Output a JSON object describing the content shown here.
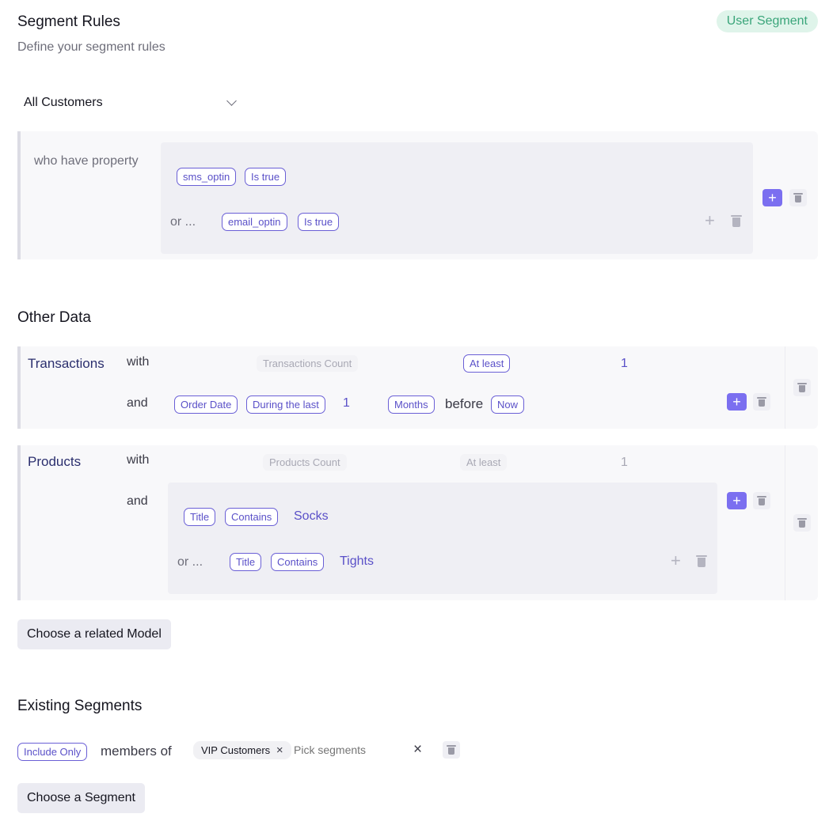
{
  "header": {
    "title": "Segment Rules",
    "subtitle": "Define your segment rules",
    "badge": "User Segment"
  },
  "audience_select": {
    "value": "All Customers"
  },
  "property_rule": {
    "label": "who have property",
    "conditions": [
      {
        "connector": "",
        "property": "sms_optin",
        "operator": "Is true"
      },
      {
        "connector": "or ...",
        "property": "email_optin",
        "operator": "Is true"
      }
    ]
  },
  "other_data": {
    "title": "Other Data",
    "transactions": {
      "model": "Transactions",
      "with_label": "with",
      "count_field": "Transactions Count",
      "count_operator": "At least",
      "count_value": "1",
      "and_label": "and",
      "date_field": "Order Date",
      "date_operator": "During the last",
      "date_amount": "1",
      "date_unit": "Months",
      "before_label": "before",
      "date_anchor": "Now"
    },
    "products": {
      "model": "Products",
      "with_label": "with",
      "count_field": "Products Count",
      "count_operator": "At least",
      "count_value": "1",
      "and_label": "and",
      "conditions": [
        {
          "connector": "",
          "field": "Title",
          "operator": "Contains",
          "value": "Socks"
        },
        {
          "connector": "or ...",
          "field": "Title",
          "operator": "Contains",
          "value": "Tights"
        }
      ]
    },
    "add_model_button": "Choose a related Model"
  },
  "existing_segments": {
    "title": "Existing Segments",
    "mode": "Include Only",
    "members_label": "members of",
    "selected": [
      "VIP Customers"
    ],
    "placeholder": "Pick segments",
    "add_button": "Choose a Segment"
  }
}
